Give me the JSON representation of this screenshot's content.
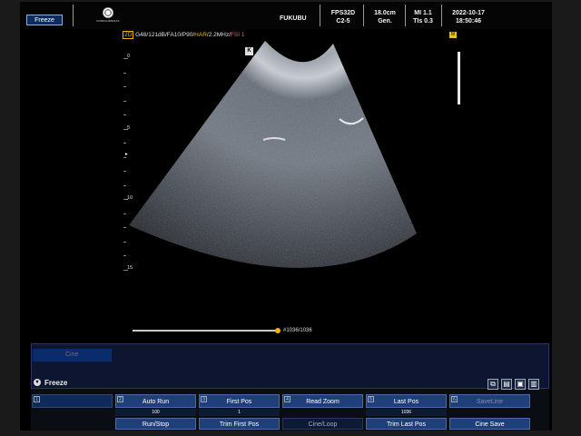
{
  "header": {
    "freeze_button": "Freeze",
    "logo_text": "KONICA MINOLTA",
    "hospital": "FUKUBU",
    "probe": "FPS32D",
    "preset": "C2-5",
    "depth": "18.0cm",
    "mode": "Gen.",
    "mi": "MI 1.1",
    "tis": "TIs 0.3",
    "date": "2022-10-17",
    "time": "18:50:46"
  },
  "image_params": {
    "tag": "2D",
    "params": " G48/121dB/FA10/P90/",
    "har": "HAR",
    "freq": "/2.2MHz/",
    "fsi": "FSI 1"
  },
  "image": {
    "orientation_marker": "K",
    "badge": "M",
    "depth_labels": [
      "0",
      "5",
      "10",
      "15"
    ],
    "focus_marker": "▸"
  },
  "cine": {
    "frame_counter": "#1036/1036",
    "progress": 1.0
  },
  "panel": {
    "tab_label": "Cine",
    "title": "Freeze",
    "icons": [
      "camera-icon",
      "clipboard-icon",
      "disk-icon",
      "save-file-icon"
    ],
    "columns": [
      {
        "num": "1",
        "head": "",
        "value": "",
        "bottom": ""
      },
      {
        "num": "2",
        "head": "Auto Run",
        "value": "100",
        "bottom": "Run/Stop"
      },
      {
        "num": "3",
        "head": "First Pos",
        "value": "1",
        "bottom": "Trim First Pos"
      },
      {
        "num": "4",
        "head": "Read Zoom",
        "value": "",
        "bottom": "Cine/Loop"
      },
      {
        "num": "5",
        "head": "Last Pos",
        "value": "1036",
        "bottom": "Trim Last Pos"
      },
      {
        "num": "6",
        "head": "SaveLine",
        "value": "",
        "bottom": "Cine Save"
      }
    ]
  },
  "colors": {
    "accent": "#f0b400",
    "button_blue": "#1f3f7a",
    "fsi_red": "#ff5959"
  }
}
